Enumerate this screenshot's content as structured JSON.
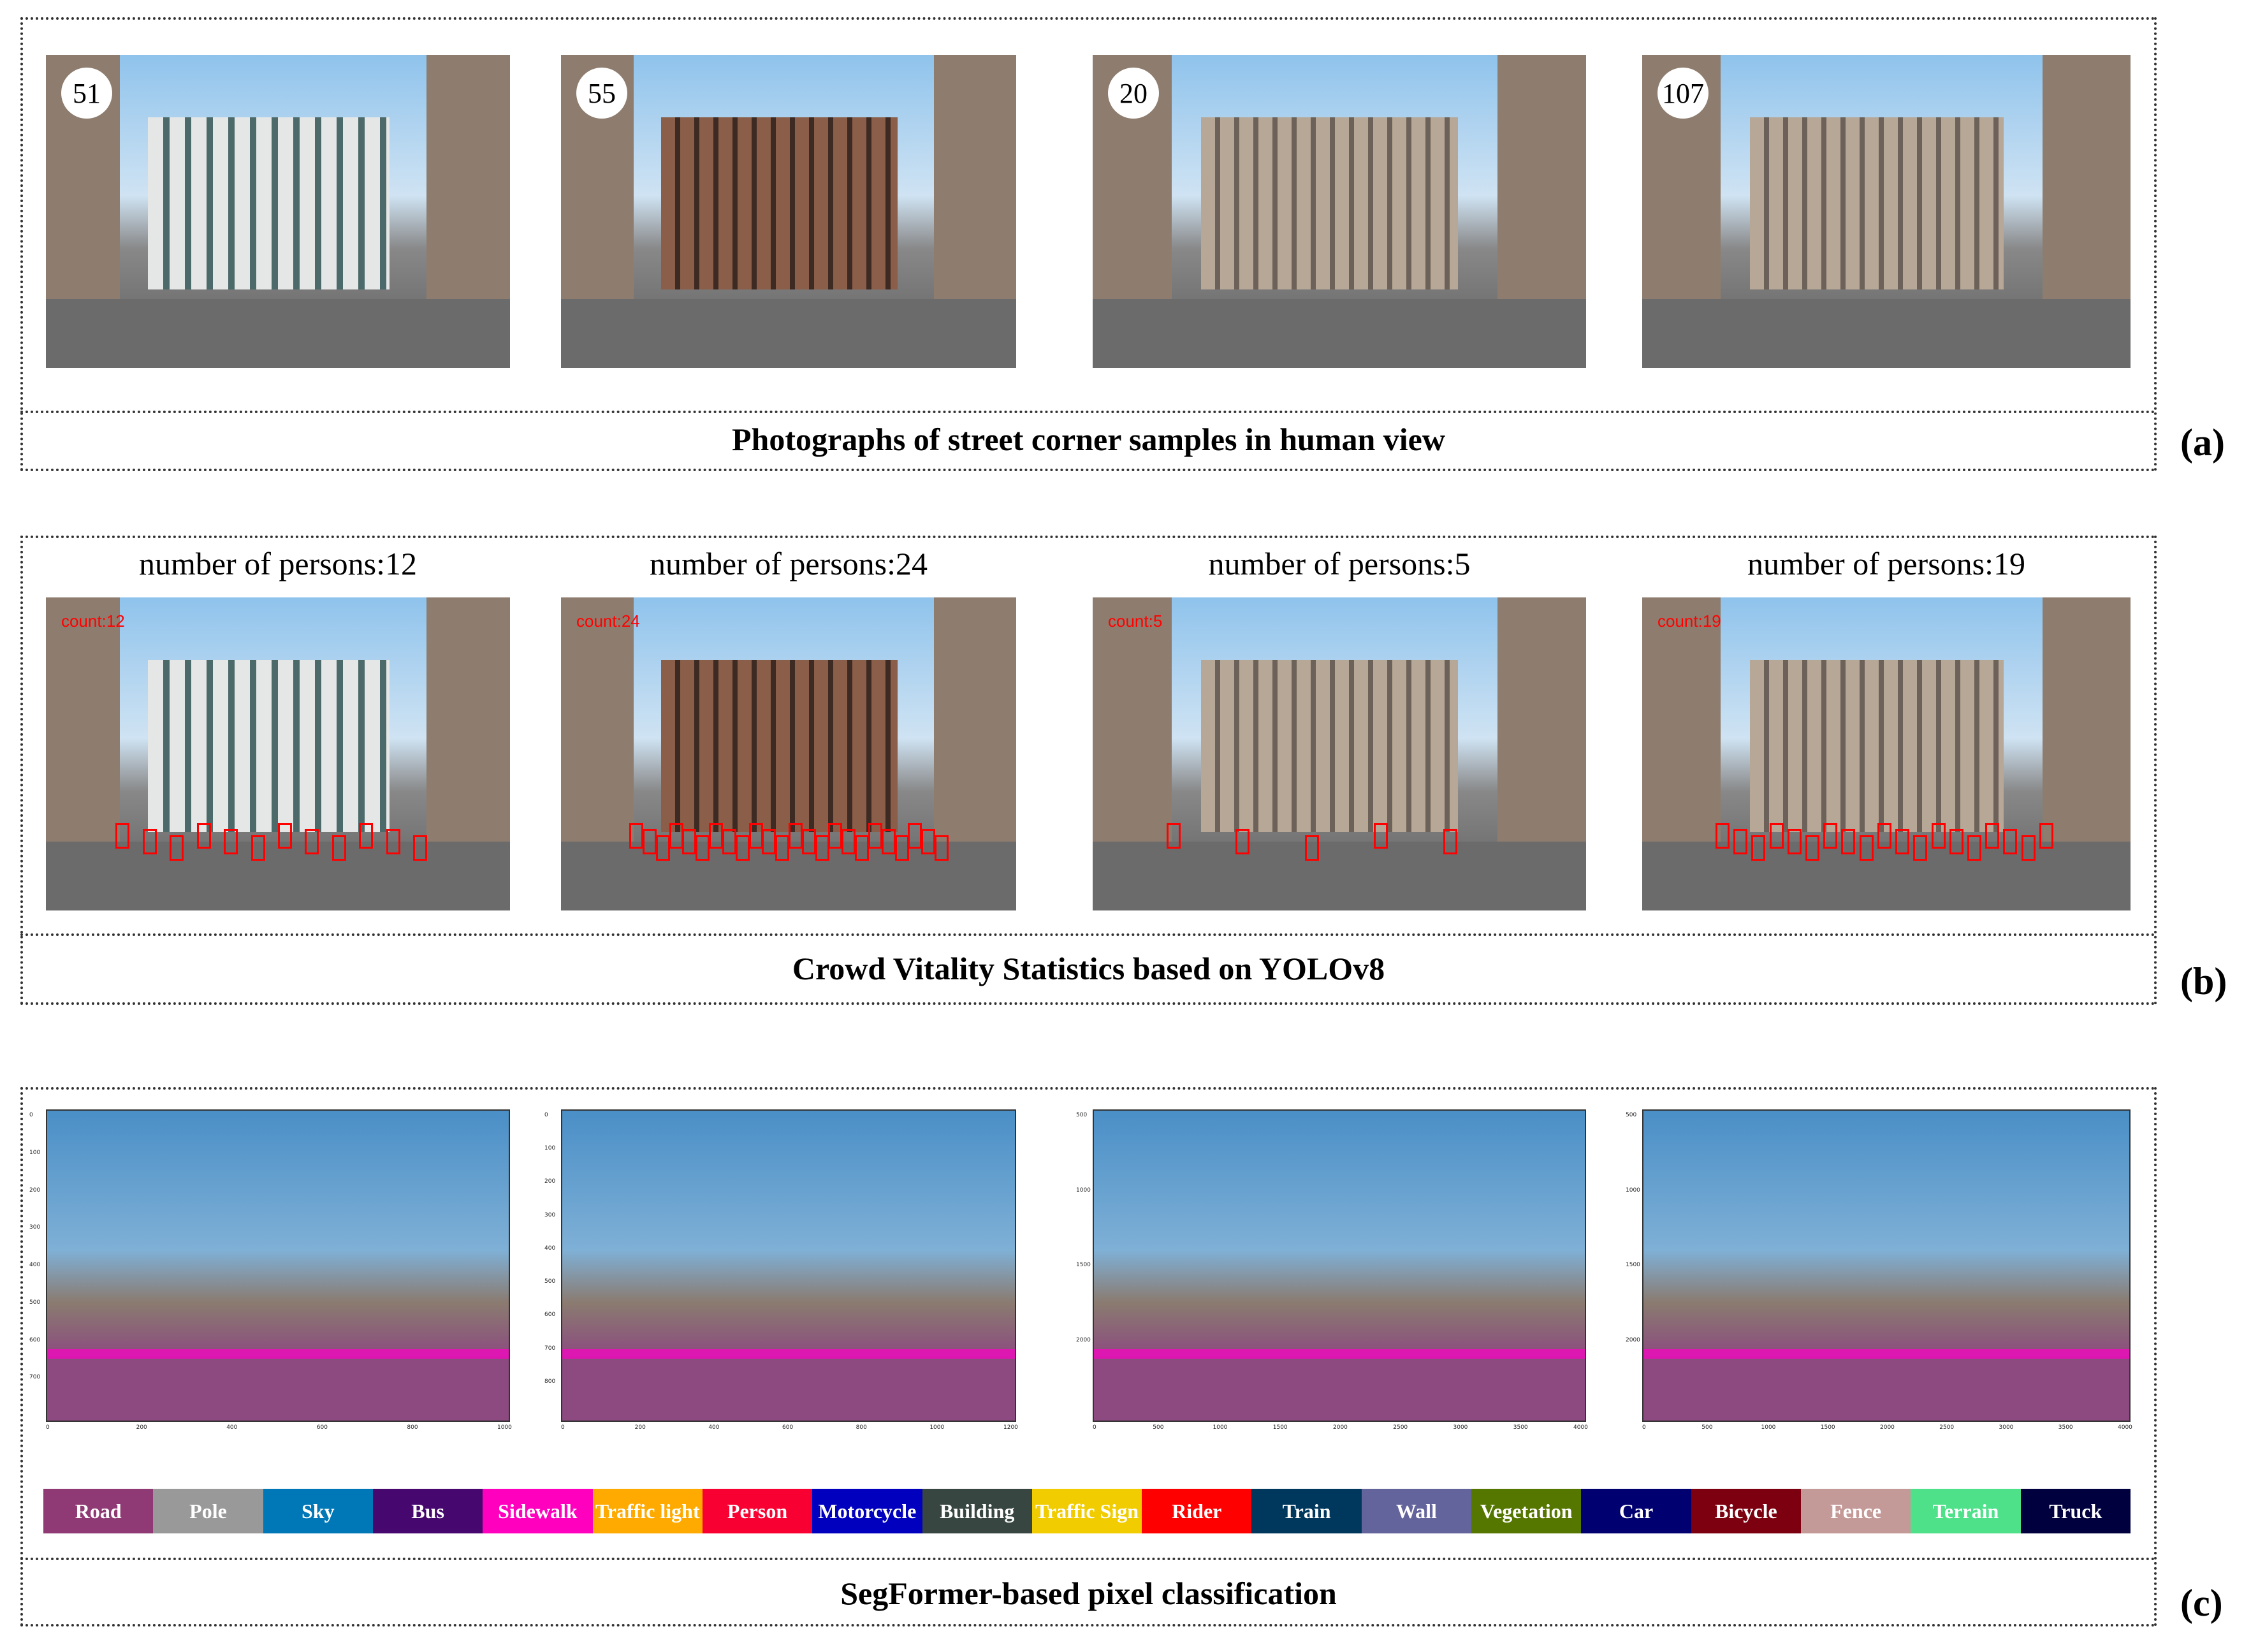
{
  "panel_a": {
    "caption": "Photographs of street corner samples in human view",
    "label": "(a)",
    "photos": [
      {
        "badge": "51",
        "style": "w"
      },
      {
        "badge": "55",
        "style": "b"
      },
      {
        "badge": "20",
        "style": ""
      },
      {
        "badge": "107",
        "style": ""
      }
    ]
  },
  "panel_b": {
    "caption": "Crowd Vitality Statistics based on YOLOv8",
    "label": "(b)",
    "photos": [
      {
        "title": "number of persons:12",
        "count": "count:12",
        "persons": 12,
        "style": "w"
      },
      {
        "title": "number of persons:24",
        "count": "count:24",
        "persons": 24,
        "style": "b"
      },
      {
        "title": "number of persons:5",
        "count": "count:5",
        "persons": 5,
        "style": ""
      },
      {
        "title": "number of persons:19",
        "count": "count:19",
        "persons": 19,
        "style": ""
      }
    ]
  },
  "panel_c": {
    "caption": "SegFormer-based pixel classification",
    "label": "(c)",
    "images": [
      {
        "xticks": [
          "0",
          "200",
          "400",
          "600",
          "800",
          "1000"
        ],
        "yticks": [
          "0",
          "100",
          "200",
          "300",
          "400",
          "500",
          "600",
          "700"
        ]
      },
      {
        "xticks": [
          "0",
          "200",
          "400",
          "600",
          "800",
          "1000",
          "1200"
        ],
        "yticks": [
          "0",
          "100",
          "200",
          "300",
          "400",
          "500",
          "600",
          "700",
          "800"
        ]
      },
      {
        "xticks": [
          "0",
          "500",
          "1000",
          "1500",
          "2000",
          "2500",
          "3000",
          "3500",
          "4000"
        ],
        "yticks": [
          "500",
          "1000",
          "1500",
          "2000"
        ]
      },
      {
        "xticks": [
          "0",
          "500",
          "1000",
          "1500",
          "2000",
          "2500",
          "3000",
          "3500",
          "4000"
        ],
        "yticks": [
          "500",
          "1000",
          "1500",
          "2000"
        ]
      }
    ],
    "legend": [
      {
        "label": "Road",
        "color": "#8f3a74"
      },
      {
        "label": "Pole",
        "color": "#999999"
      },
      {
        "label": "Sky",
        "color": "#0077b6"
      },
      {
        "label": "Bus",
        "color": "#46086e"
      },
      {
        "label": "Sidewalk",
        "color": "#ff00be"
      },
      {
        "label": "Traffic light",
        "color": "#ffaa00"
      },
      {
        "label": "Person",
        "color": "#f80032"
      },
      {
        "label": "Motorcycle",
        "color": "#0000be"
      },
      {
        "label": "Building",
        "color": "#374641"
      },
      {
        "label": "Traffic Sign",
        "color": "#f0cc00"
      },
      {
        "label": "Rider",
        "color": "#ff0000"
      },
      {
        "label": "Train",
        "color": "#00375c"
      },
      {
        "label": "Wall",
        "color": "#64649c"
      },
      {
        "label": "Vegetation",
        "color": "#557700"
      },
      {
        "label": "Car",
        "color": "#000070"
      },
      {
        "label": "Bicycle",
        "color": "#7c0010"
      },
      {
        "label": "Fence",
        "color": "#c49a98"
      },
      {
        "label": "Terrain",
        "color": "#4ee18a"
      },
      {
        "label": "Truck",
        "color": "#00003e"
      }
    ]
  }
}
